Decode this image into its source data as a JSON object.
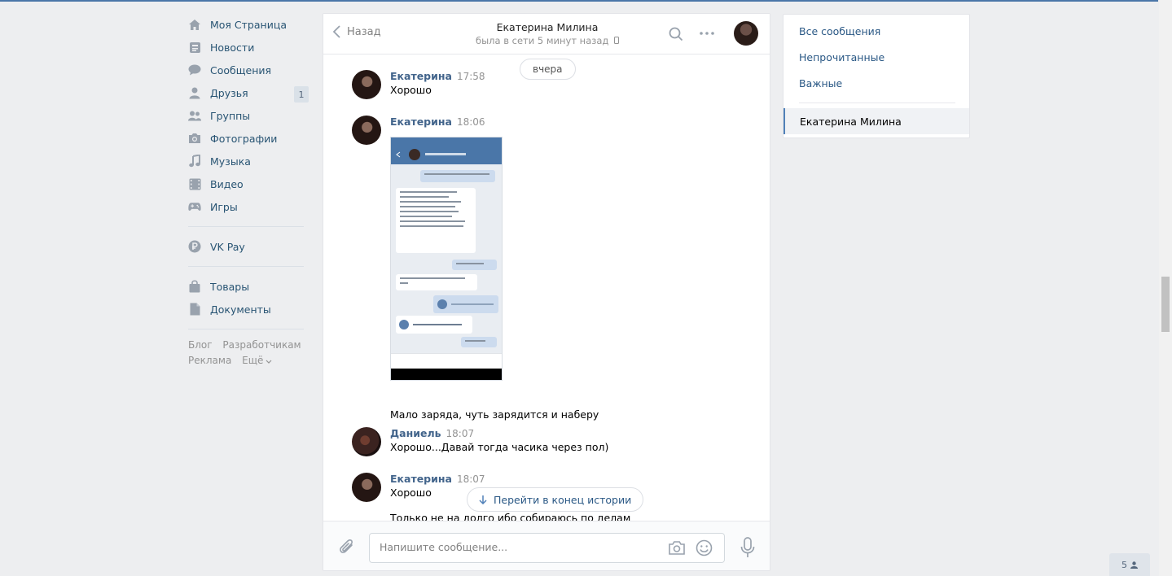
{
  "sidebar": {
    "items": [
      {
        "label": "Моя Страница",
        "icon": "home-icon"
      },
      {
        "label": "Новости",
        "icon": "news-icon"
      },
      {
        "label": "Сообщения",
        "icon": "messages-icon"
      },
      {
        "label": "Друзья",
        "icon": "friends-icon",
        "badge": "1"
      },
      {
        "label": "Группы",
        "icon": "groups-icon"
      },
      {
        "label": "Фотографии",
        "icon": "camera-icon"
      },
      {
        "label": "Музыка",
        "icon": "music-icon"
      },
      {
        "label": "Видео",
        "icon": "video-icon"
      },
      {
        "label": "Игры",
        "icon": "gamepad-icon"
      }
    ],
    "vkpay": {
      "label": "VK Pay",
      "icon": "vkpay-icon"
    },
    "extra": [
      {
        "label": "Товары",
        "icon": "bag-icon"
      },
      {
        "label": "Документы",
        "icon": "document-icon"
      }
    ],
    "footer": {
      "blog": "Блог",
      "developers": "Разработчикам",
      "ads": "Реклама",
      "more": "Ещё"
    }
  },
  "chat": {
    "back_label": "Назад",
    "peer_name": "Екатерина Милина",
    "peer_status": "была в сети 5 минут назад",
    "date_pill": "вчера",
    "messages": [
      {
        "author": "Екатерина",
        "time": "17:58",
        "text": "Хорошо"
      },
      {
        "author": "Екатерина",
        "time": "18:06",
        "text": "Мало заряда, чуть зарядится и наберу"
      },
      {
        "author": "Даниель",
        "time": "18:07",
        "text": "Хорошо...Давай тогда часика через пол)"
      },
      {
        "author": "Екатерина",
        "time": "18:07",
        "text": "Хорошо",
        "text2": "Только не на долго ибо собираюсь по делам"
      }
    ],
    "jump_button": "Перейти в конец истории",
    "composer_placeholder": "Напишите сообщение..."
  },
  "filters": {
    "all": "Все сообщения",
    "unread": "Непрочитанные",
    "important": "Важные",
    "active_chat": "Екатерина Милина"
  },
  "friends_online": "5",
  "colors": {
    "accent": "#4a76a8",
    "link": "#2a5885",
    "author": "#42648b",
    "background": "#edeef0"
  }
}
